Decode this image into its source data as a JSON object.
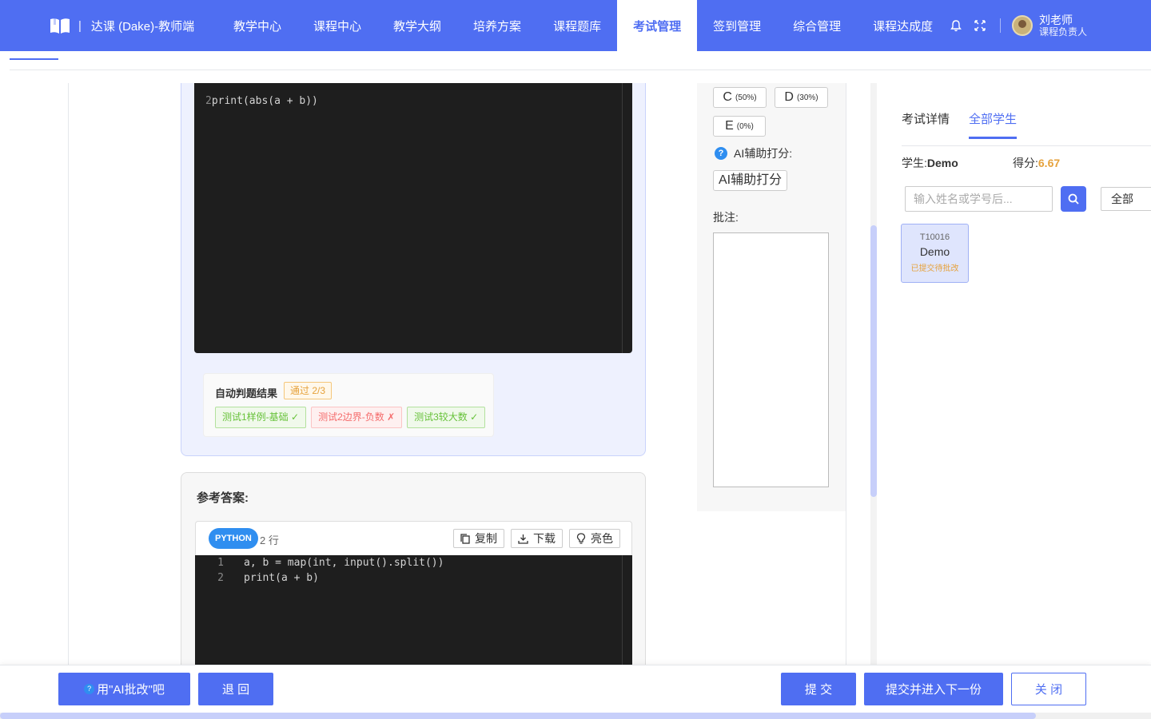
{
  "app": {
    "title": "达课 (Dake)-教师端",
    "separator": "|",
    "brand_color": "#4f6ef2"
  },
  "nav": {
    "items": [
      {
        "label": "教学中心"
      },
      {
        "label": "课程中心"
      },
      {
        "label": "教学大纲"
      },
      {
        "label": "培养方案"
      },
      {
        "label": "课程题库"
      },
      {
        "label": "考试管理",
        "active": true
      },
      {
        "label": "签到管理"
      },
      {
        "label": "综合管理"
      },
      {
        "label": "课程达成度"
      }
    ],
    "icons": [
      "bell-icon",
      "fullscreen-icon"
    ],
    "user": {
      "name": "刘老师",
      "role": "课程负责人"
    }
  },
  "student_answer": {
    "code_lines": [
      {
        "num": "2",
        "text": "print(abs(a + b))"
      }
    ],
    "judge": {
      "title": "自动判题结果",
      "pass_badge": "通过 2/3",
      "tests": [
        {
          "label": "测试1样例-基础 ✓",
          "status": "pass"
        },
        {
          "label": "测试2边界-负数 ✗",
          "status": "fail"
        },
        {
          "label": "测试3较大数 ✓",
          "status": "pass"
        }
      ]
    }
  },
  "reference": {
    "title": "参考答案:",
    "language": "PYTHON",
    "line_count": "2 行",
    "buttons": {
      "copy": "复制",
      "download": "下载",
      "theme": "亮色"
    },
    "code_lines": [
      {
        "num": "1",
        "text": "a, b = map(int, input().split())"
      },
      {
        "num": "2",
        "text": "print(a + b)"
      }
    ]
  },
  "grading": {
    "grades": [
      {
        "letter": "C",
        "pct": "(50%)"
      },
      {
        "letter": "D",
        "pct": "(30%)"
      },
      {
        "letter": "E",
        "pct": "(0%)"
      }
    ],
    "ai_help_label": "AI辅助打分:",
    "ai_score_button": "AI辅助打分",
    "comment_label": "批注:"
  },
  "students": {
    "tabs": [
      {
        "label": "考试详情"
      },
      {
        "label": "全部学生",
        "active": true
      }
    ],
    "student_label": "学生:",
    "student_name": "Demo",
    "score_label": "得分:",
    "score": "6.67",
    "search_placeholder": "输入姓名或学号后...",
    "filter_value": "全部",
    "cards": [
      {
        "id": "T10016",
        "name": "Demo",
        "status": "已提交待批改"
      }
    ]
  },
  "footer": {
    "ai_grade": "用\"AI批改\"吧",
    "back": "退 回",
    "submit": "提 交",
    "submit_next": "提交并进入下一份",
    "close": "关 闭"
  }
}
